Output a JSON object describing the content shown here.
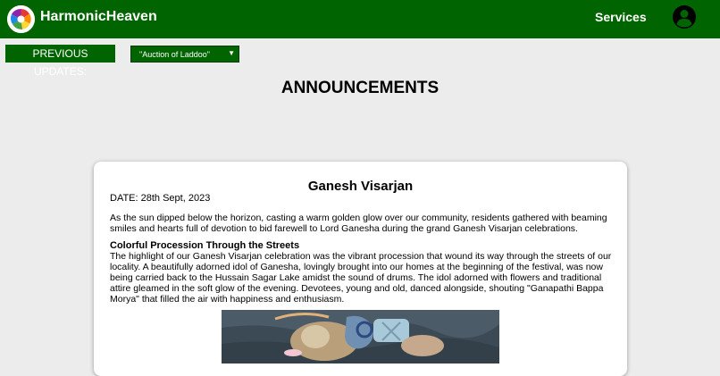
{
  "navbar": {
    "brand": "HarmonicHeaven",
    "services_label": "Services",
    "logo_icon": "rainbow-swirl-icon",
    "account_icon": "account-circle-icon",
    "bg_color": "#006400"
  },
  "updates": {
    "label": "PREVIOUS UPDATES:",
    "selected": "\"Auction of Laddoo\""
  },
  "page": {
    "title": "ANNOUNCEMENTS"
  },
  "announcement": {
    "title": "Ganesh Visarjan",
    "date": "DATE: 28th Sept, 2023",
    "intro": "As the sun dipped below the horizon, casting a warm golden glow over our community, residents gathered with beaming smiles and hearts full of devotion to bid farewell to Lord Ganesha during the grand Ganesh Visarjan celebrations.",
    "section_heading": "Colorful Procession Through the Streets",
    "section_body": "The highlight of our Ganesh Visarjan celebration was the vibrant procession that wound its way through the streets of our locality. A beautifully adorned idol of Ganesha, lovingly brought into our homes at the beginning of the festival, was now being carried back to the Hussain Sagar Lake amidst the sound of drums. The idol adorned with flowers and traditional attire gleamed in the soft glow of the evening. Devotees, young and old, danced alongside, shouting \"Ganapathi Bappa Morya\" that filled the air with happiness and enthusiasm."
  }
}
